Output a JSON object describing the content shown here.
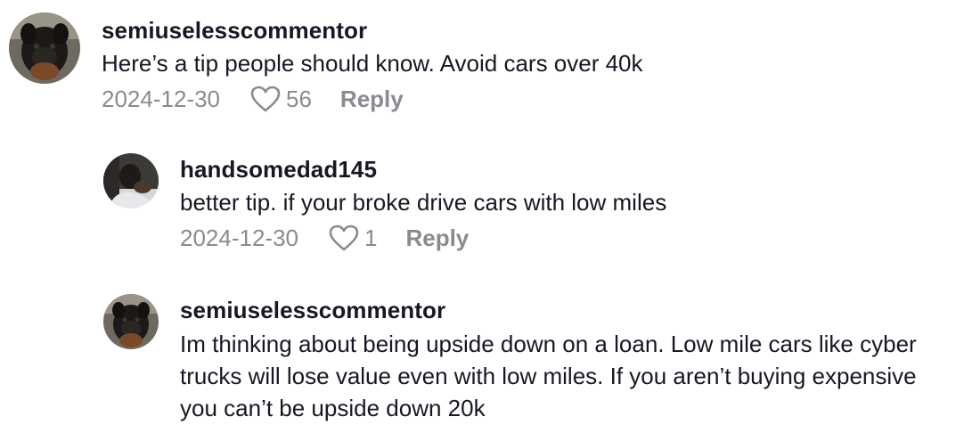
{
  "comments": [
    {
      "username": "semiuselesscommentor",
      "text": "Here’s a tip people should know. Avoid cars over 40k",
      "date": "2024-12-30",
      "likes": "56",
      "reply_label": "Reply",
      "avatar_icon": "dog-avatar"
    },
    {
      "username": "handsomedad145",
      "text": "better tip. if your broke drive cars with low miles",
      "date": "2024-12-30",
      "likes": "1",
      "reply_label": "Reply",
      "avatar_icon": "person-avatar"
    },
    {
      "username": "semiuselesscommentor",
      "text": "Im thinking about being upside down on a loan. Low mile cars like cyber trucks will lose value even with low miles. If you aren’t buying expensive you can’t be upside down 20k",
      "avatar_icon": "dog-avatar"
    }
  ],
  "colors": {
    "text_primary": "#161823",
    "text_secondary": "#8a8b91",
    "background": "#ffffff"
  },
  "icons": {
    "like": "heart-outline-icon"
  }
}
